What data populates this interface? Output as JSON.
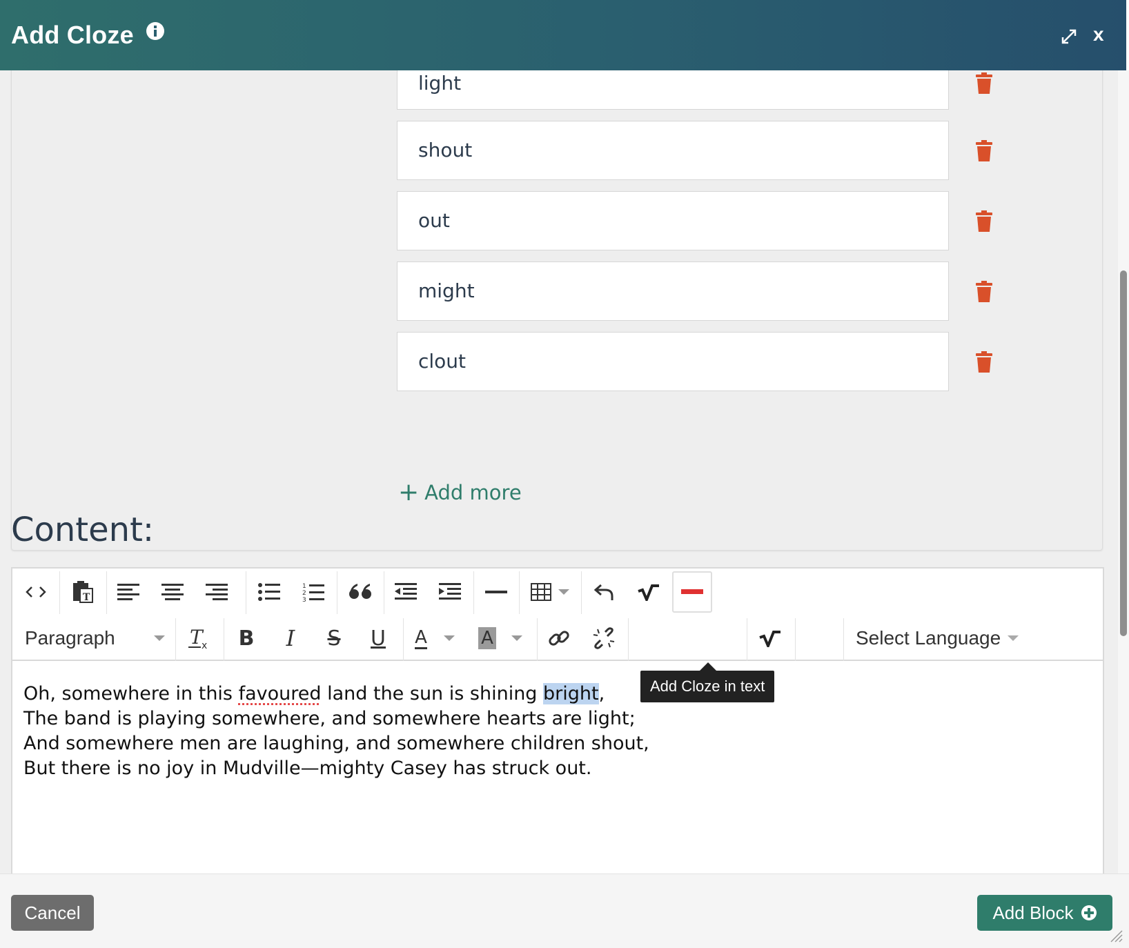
{
  "header": {
    "title": "Add Cloze",
    "close_label": "x"
  },
  "answers": [
    {
      "value": "light"
    },
    {
      "value": "shout"
    },
    {
      "value": "out"
    },
    {
      "value": "might"
    },
    {
      "value": "clout"
    }
  ],
  "add_more_label": "Add more",
  "content_label": "Content:",
  "toolbar": {
    "paragraph_label": "Paragraph",
    "language_label": "Select Language",
    "tooltip": "Add Cloze in text"
  },
  "editor_text": {
    "line1_a": "Oh, somewhere in this ",
    "line1_spell": "favoured",
    "line1_b": " land the sun is shining ",
    "line1_selected": "bright",
    "line1_c": ",",
    "line2": "The band is playing somewhere, and somewhere hearts are light;",
    "line3": "And somewhere men are laughing, and somewhere children shout,",
    "line4": "But there is no joy in Mudville—mighty Casey has struck out."
  },
  "footer": {
    "cancel_label": "Cancel",
    "add_block_label": "Add Block"
  },
  "colors": {
    "header_teal": "#2f6e6c",
    "accent_green": "#2f7d6b",
    "delete_red": "#d9502a",
    "cloze_red": "#e03131"
  }
}
